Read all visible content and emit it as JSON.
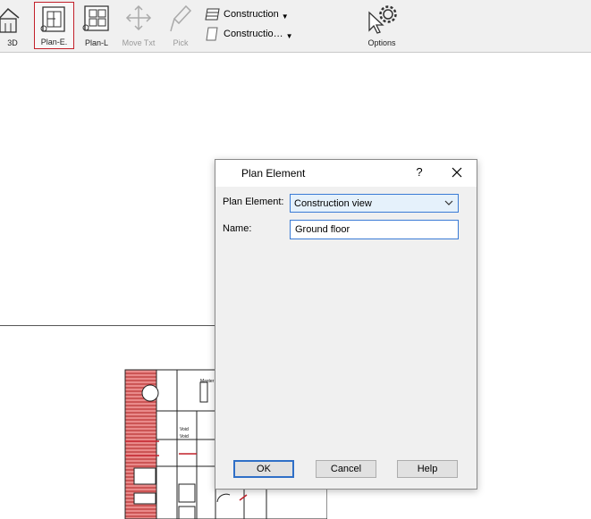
{
  "toolbar": {
    "buttons": [
      {
        "label": "3D"
      },
      {
        "label": "Plan-E."
      },
      {
        "label": "Plan-L"
      },
      {
        "label": "Move Txt"
      },
      {
        "label": "Pick"
      },
      {
        "label": "Options"
      }
    ],
    "dropdowns": [
      {
        "label": "Construction"
      },
      {
        "label": "Constructio…"
      }
    ]
  },
  "plan_labels": [
    "Master",
    "Void",
    "Void"
  ],
  "dialog": {
    "title": "Plan Element",
    "help": "?",
    "plan_element_label": "Plan Element:",
    "plan_element_value": "Construction view",
    "name_label": "Name:",
    "name_value": "Ground floor",
    "ok": "OK",
    "cancel": "Cancel",
    "help_button": "Help"
  },
  "colors": {
    "accent": "#3a7bd5",
    "hatch": "#c2202a"
  }
}
